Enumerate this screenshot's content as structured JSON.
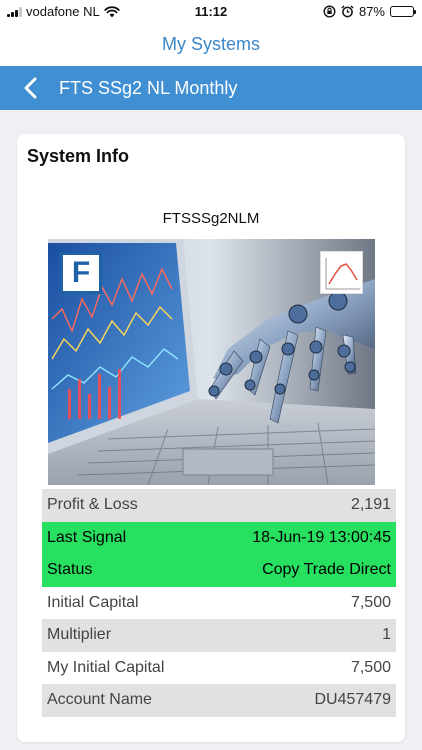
{
  "status_bar": {
    "carrier": "vodafone NL",
    "time": "11:12",
    "battery": "87%",
    "battery_level": 0.87
  },
  "header": {
    "title": "My Systems"
  },
  "nav": {
    "back_icon": "chevron-left-icon",
    "title": "FTS SSg2 NL Monthly"
  },
  "card": {
    "title": "System Info",
    "system_name": "FTSSSg2NLM",
    "image": {
      "logo_letter": "F",
      "subject": "robot-hand-typing-on-laptop"
    },
    "rows": [
      {
        "label": "Profit & Loss",
        "value": "2,191",
        "style": "shade"
      },
      {
        "label": "Last Signal",
        "value": "18-Jun-19 13:00:45",
        "style": "highlight"
      },
      {
        "label": "Status",
        "value": "Copy Trade Direct",
        "style": "highlight"
      },
      {
        "label": "Initial Capital",
        "value": "7,500",
        "style": "plain"
      },
      {
        "label": "Multiplier",
        "value": "1",
        "style": "shade"
      },
      {
        "label": "My Initial Capital",
        "value": "7,500",
        "style": "plain"
      },
      {
        "label": "Account Name",
        "value": "DU457479",
        "style": "shade"
      }
    ]
  },
  "colors": {
    "nav_blue": "#3f8fd2",
    "header_text": "#3a87c8",
    "highlight_green": "#27e060",
    "shade_gray": "#e1e1e1"
  }
}
